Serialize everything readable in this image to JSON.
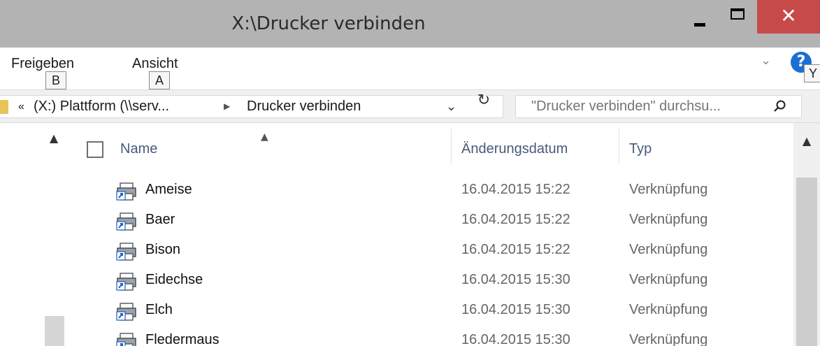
{
  "window": {
    "title": "X:\\Drucker verbinden",
    "minimize_glyph": "",
    "close_glyph": "✕"
  },
  "ribbon": {
    "tabs": [
      {
        "label": "Freigeben",
        "keytip": "B"
      },
      {
        "label": "Ansicht",
        "keytip": "A"
      }
    ],
    "help_glyph": "?",
    "help_keytip": "Y"
  },
  "address": {
    "overflow": "«",
    "crumbs": [
      "(X:) Plattform (\\\\serv...",
      "Drucker verbinden"
    ]
  },
  "search": {
    "placeholder": "\"Drucker verbinden\" durchsu..."
  },
  "columns": {
    "name": "Name",
    "date": "Änderungsdatum",
    "type": "Typ"
  },
  "files": [
    {
      "name": "Ameise",
      "date": "16.04.2015 15:22",
      "type": "Verknüpfung"
    },
    {
      "name": "Baer",
      "date": "16.04.2015 15:22",
      "type": "Verknüpfung"
    },
    {
      "name": "Bison",
      "date": "16.04.2015 15:22",
      "type": "Verknüpfung"
    },
    {
      "name": "Eidechse",
      "date": "16.04.2015 15:30",
      "type": "Verknüpfung"
    },
    {
      "name": "Elch",
      "date": "16.04.2015 15:30",
      "type": "Verknüpfung"
    },
    {
      "name": "Fledermaus",
      "date": "16.04.2015 15:30",
      "type": "Verknüpfung"
    }
  ],
  "colors": {
    "close": "#c74a4a",
    "titlebar": "#b3b3b3",
    "help": "#1c6fd1"
  },
  "icons": {
    "file": "printer-shortcut-icon",
    "folder": "folder-icon",
    "search": "search-icon",
    "refresh": "refresh-icon"
  }
}
